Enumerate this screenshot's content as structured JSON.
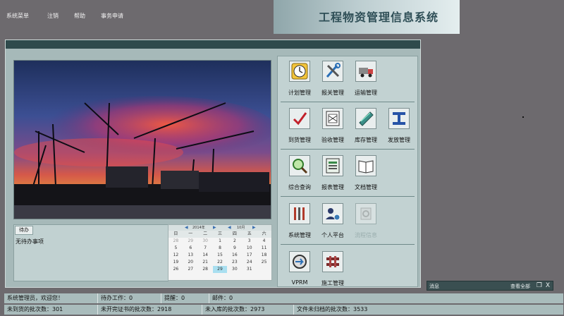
{
  "menu": {
    "items": [
      "系统菜单",
      "注销",
      "帮助",
      "事务申请"
    ]
  },
  "header": {
    "title": "工程物资管理信息系统"
  },
  "todo": {
    "tab_label": "待办",
    "empty_text": "无待办事项"
  },
  "calendar": {
    "year_label": "2014年",
    "month_label": "10月",
    "weekdays": [
      "日",
      "一",
      "二",
      "三",
      "四",
      "五",
      "六"
    ],
    "days": [
      {
        "d": "28",
        "muted": true
      },
      {
        "d": "29",
        "muted": true
      },
      {
        "d": "30",
        "muted": true
      },
      {
        "d": "1"
      },
      {
        "d": "2"
      },
      {
        "d": "3"
      },
      {
        "d": "4"
      },
      {
        "d": "5"
      },
      {
        "d": "6"
      },
      {
        "d": "7"
      },
      {
        "d": "8"
      },
      {
        "d": "9"
      },
      {
        "d": "10"
      },
      {
        "d": "11"
      },
      {
        "d": "12"
      },
      {
        "d": "13"
      },
      {
        "d": "14"
      },
      {
        "d": "15"
      },
      {
        "d": "16"
      },
      {
        "d": "17"
      },
      {
        "d": "18"
      },
      {
        "d": "19"
      },
      {
        "d": "20"
      },
      {
        "d": "21"
      },
      {
        "d": "22"
      },
      {
        "d": "23"
      },
      {
        "d": "24"
      },
      {
        "d": "25"
      },
      {
        "d": "26"
      },
      {
        "d": "27"
      },
      {
        "d": "28"
      },
      {
        "d": "29",
        "today": true
      },
      {
        "d": "30"
      },
      {
        "d": "31"
      }
    ]
  },
  "modules": {
    "rows": [
      [
        {
          "label": "计划管理",
          "icon": "clock-icon"
        },
        {
          "label": "报关管理",
          "icon": "tools-icon"
        },
        {
          "label": "运输管理",
          "icon": "truck-icon"
        }
      ],
      [
        {
          "label": "到货管理",
          "icon": "checkmark-icon"
        },
        {
          "label": "验收管理",
          "icon": "inspection-icon"
        },
        {
          "label": "库存管理",
          "icon": "steel-beam-icon"
        },
        {
          "label": "发放管理",
          "icon": "i-beam-icon"
        }
      ],
      [
        {
          "label": "综合查询",
          "icon": "magnifier-icon"
        },
        {
          "label": "报表管理",
          "icon": "report-icon"
        },
        {
          "label": "文档管理",
          "icon": "book-icon"
        }
      ],
      [
        {
          "label": "系统管理",
          "icon": "toolbox-icon"
        },
        {
          "label": "个人平台",
          "icon": "user-gear-icon"
        },
        {
          "label": "流程信息",
          "icon": "workflow-icon",
          "disabled": true
        }
      ],
      [
        {
          "label": "VPRM",
          "icon": "vprm-icon"
        },
        {
          "label": "施工管理",
          "icon": "pipes-icon"
        }
      ]
    ]
  },
  "messages": {
    "title": "消息",
    "view_all": "查看全部",
    "restore_glyph": "❐",
    "close_glyph": "X"
  },
  "status": {
    "row1": [
      "系统管理员，欢迎您！",
      "待办工作：0",
      "提醒：0",
      "邮件：0"
    ],
    "row2": [
      "未到货的批次数：301",
      "未开完证书的批次数：2918",
      "未入库的批次数：2973",
      "文件未归档的批次数：3533"
    ]
  },
  "colors": {
    "accent": "#2f4a4c",
    "panel": "#a6b9b9",
    "today": "#a9dff0"
  }
}
